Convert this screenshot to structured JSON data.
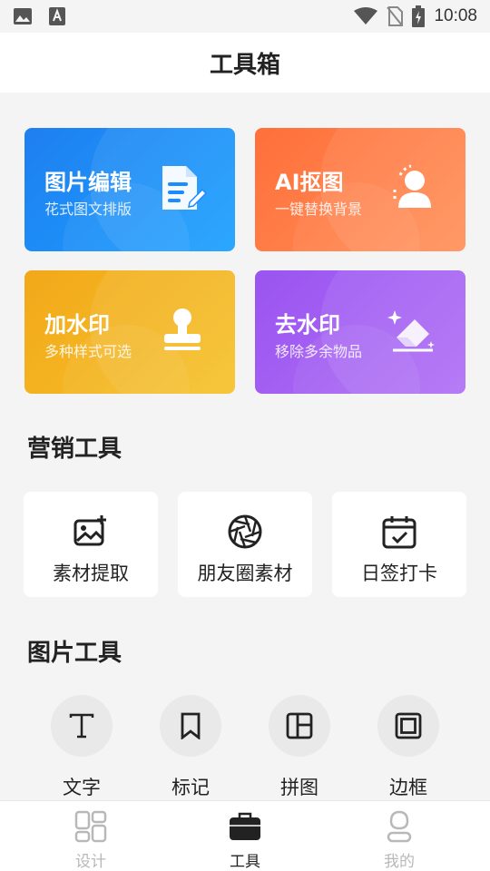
{
  "status_bar": {
    "time": "10:08",
    "icons": [
      "image-icon",
      "text-a-icon",
      "wifi-icon",
      "no-sim-icon",
      "battery-charging-icon"
    ]
  },
  "header": {
    "title": "工具箱"
  },
  "feature_cards": [
    {
      "title": "图片编辑",
      "subtitle": "花式图文排版",
      "icon": "document-edit-icon",
      "color": "#1a8cff"
    },
    {
      "title": "AI抠图",
      "subtitle": "一键替换背景",
      "icon": "portrait-cutout-icon",
      "color": "#ff7a3c"
    },
    {
      "title": "加水印",
      "subtitle": "多种样式可选",
      "icon": "stamp-icon",
      "color": "#f4b21d"
    },
    {
      "title": "去水印",
      "subtitle": "移除多余物品",
      "icon": "eraser-icon",
      "color": "#a05cf2"
    }
  ],
  "marketing": {
    "title": "营销工具",
    "items": [
      {
        "label": "素材提取",
        "icon": "image-add-icon"
      },
      {
        "label": "朋友圈素材",
        "icon": "aperture-icon"
      },
      {
        "label": "日签打卡",
        "icon": "calendar-check-icon"
      }
    ]
  },
  "image_tools": {
    "title": "图片工具",
    "items": [
      {
        "label": "文字",
        "icon": "text-t-icon"
      },
      {
        "label": "标记",
        "icon": "bookmark-icon"
      },
      {
        "label": "拼图",
        "icon": "collage-icon"
      },
      {
        "label": "边框",
        "icon": "frame-icon"
      }
    ]
  },
  "bottom_nav": {
    "items": [
      {
        "label": "设计",
        "icon": "grid-layout-icon",
        "active": false
      },
      {
        "label": "工具",
        "icon": "toolbox-icon",
        "active": true
      },
      {
        "label": "我的",
        "icon": "profile-icon",
        "active": false
      }
    ],
    "active_color": "#222222",
    "inactive_color": "#b8b8b8"
  }
}
